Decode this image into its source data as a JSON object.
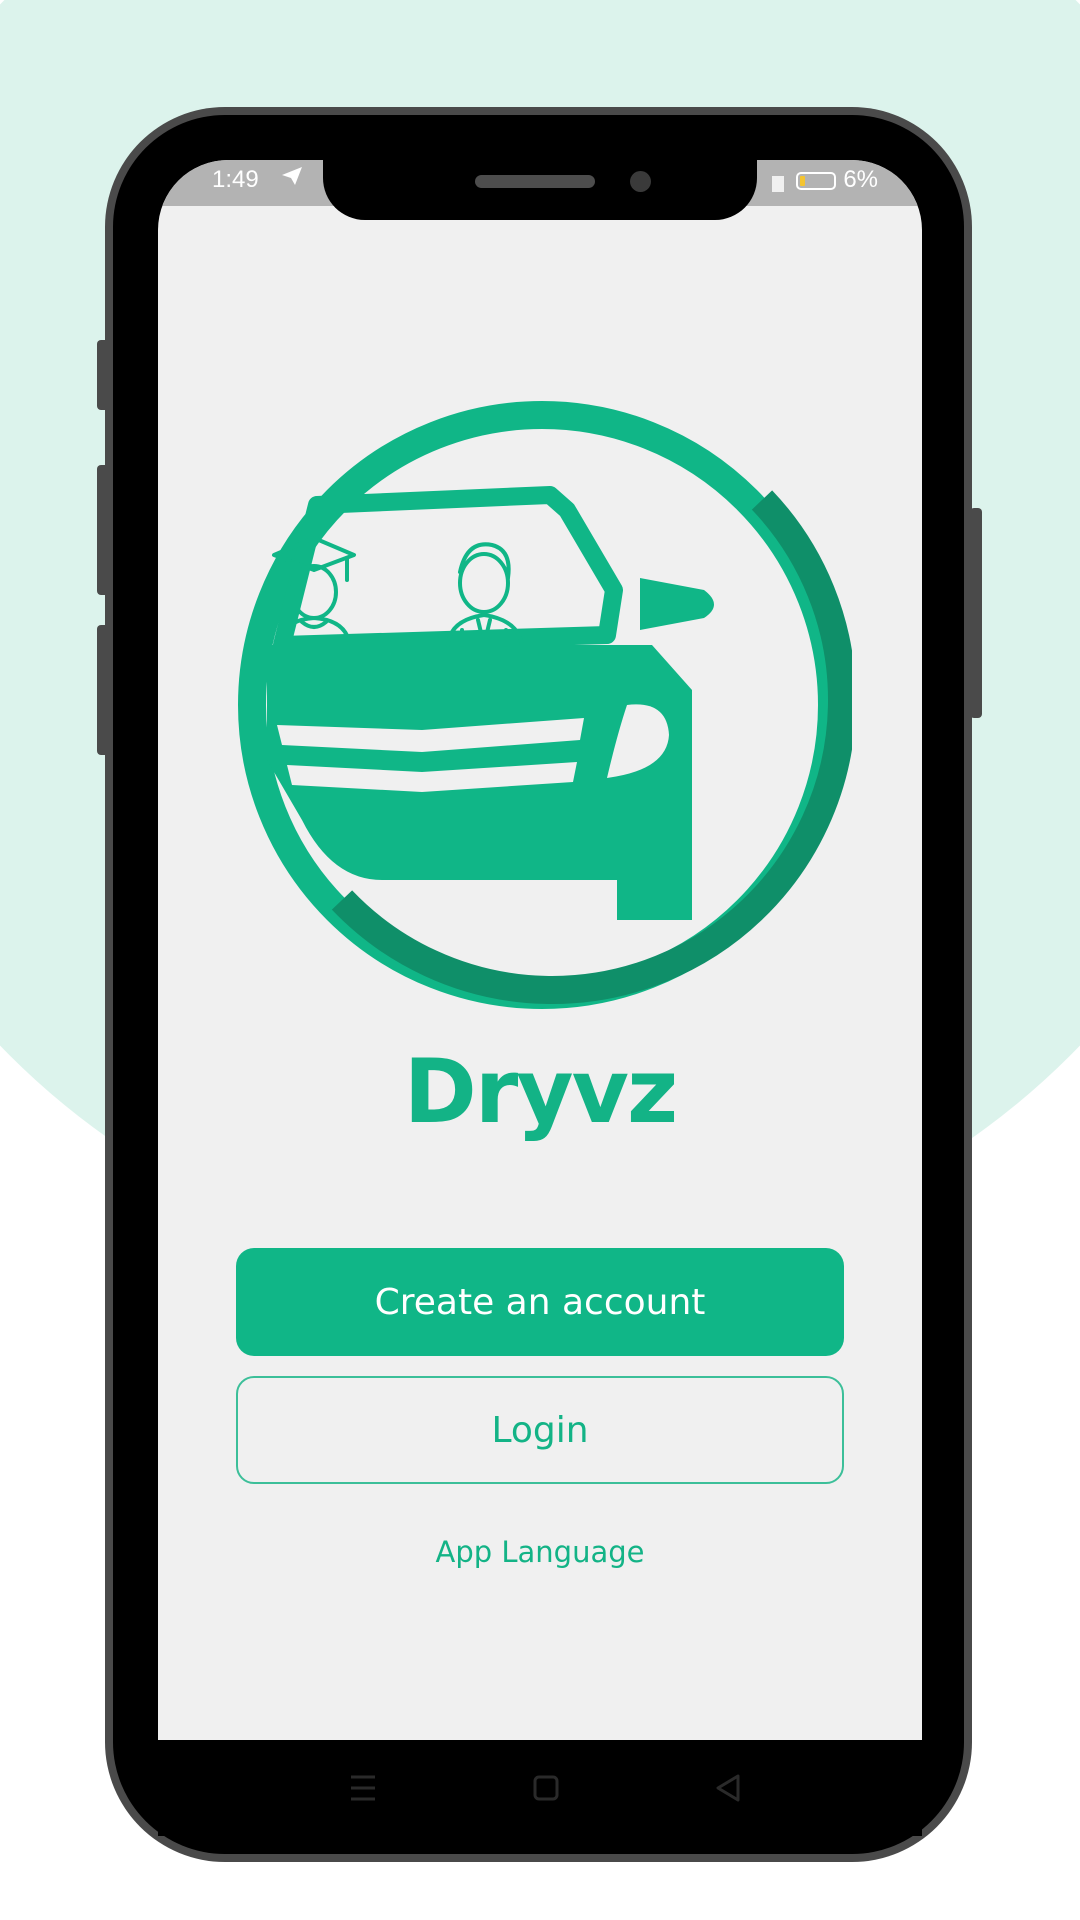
{
  "status_bar": {
    "time": "1:49",
    "send_icon": "telegram-send-icon",
    "battery_percent": "6%",
    "battery_level": 0.06,
    "signal_icon": "signal-icon",
    "battery_icon": "battery-icon"
  },
  "app": {
    "name": "Dryvz",
    "logo_icon": "car-with-student-and-instructor-logo"
  },
  "actions": {
    "create_account_label": "Create an account",
    "login_label": "Login",
    "language_label": "App Language"
  },
  "nav_bar": {
    "items": [
      "menu-icon",
      "home-square-icon",
      "back-triangle-icon"
    ]
  },
  "colors": {
    "brand": "#10b687",
    "brand_dark": "#0f8f69",
    "background_blob": "#dcf3ec",
    "screen_bg": "#f0f0f0",
    "phone_frame": "#4a4a4a"
  }
}
